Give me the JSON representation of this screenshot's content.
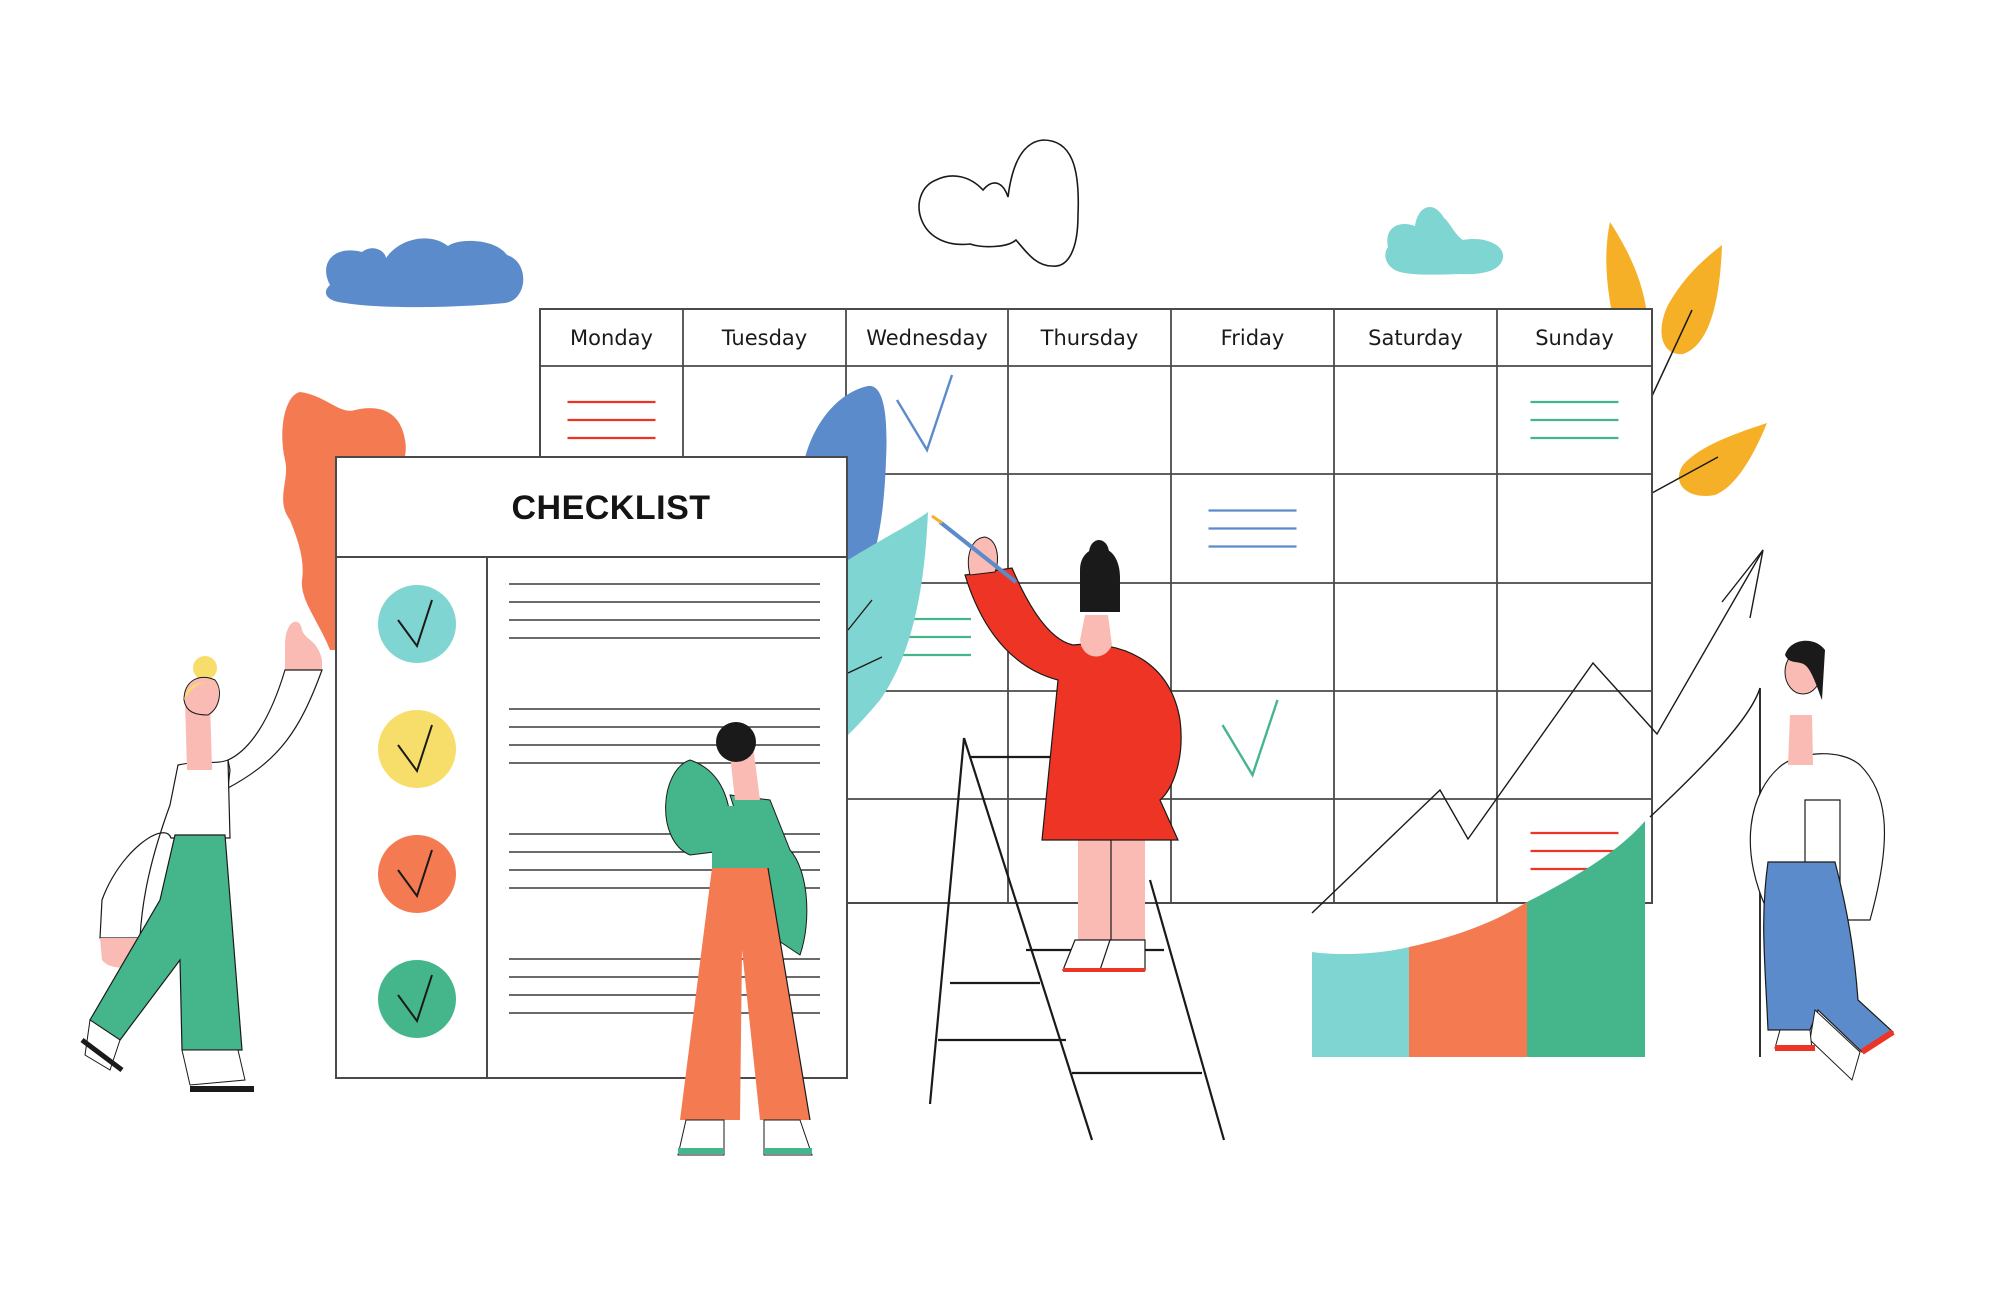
{
  "illustration": {
    "title": "Weekly planning calendar with checklist and growth chart",
    "colors": {
      "ink": "#1a1a1a",
      "grid": "#4a4a4a",
      "teal": "#7fd5d1",
      "yellow": "#f7de6b",
      "orange": "#f47a52",
      "green": "#45b68c",
      "blue": "#5b8bca",
      "red": "#ee3424",
      "gold": "#f6b027",
      "skin": "#f9bbb3"
    }
  },
  "calendar": {
    "days": [
      "Monday",
      "Tuesday",
      "Wednesday",
      "Thursday",
      "Friday",
      "Saturday",
      "Sunday"
    ],
    "rows": 5,
    "marks": [
      {
        "row": 0,
        "col": 0,
        "type": "lines",
        "color": "red"
      },
      {
        "row": 0,
        "col": 2,
        "type": "check",
        "color": "blue"
      },
      {
        "row": 0,
        "col": 6,
        "type": "lines",
        "color": "green"
      },
      {
        "row": 1,
        "col": 4,
        "type": "lines",
        "color": "blue"
      },
      {
        "row": 2,
        "col": 2,
        "type": "lines",
        "color": "green"
      },
      {
        "row": 3,
        "col": 4,
        "type": "check",
        "color": "green"
      },
      {
        "row": 4,
        "col": 6,
        "type": "lines",
        "color": "red"
      }
    ]
  },
  "checklist": {
    "title": "CHECKLIST",
    "items": [
      {
        "checked": true,
        "color": "teal"
      },
      {
        "checked": true,
        "color": "yellow"
      },
      {
        "checked": true,
        "color": "orange"
      },
      {
        "checked": true,
        "color": "green"
      }
    ]
  },
  "growth_chart": {
    "segments": [
      "teal",
      "orange",
      "green"
    ],
    "trend": "up"
  }
}
